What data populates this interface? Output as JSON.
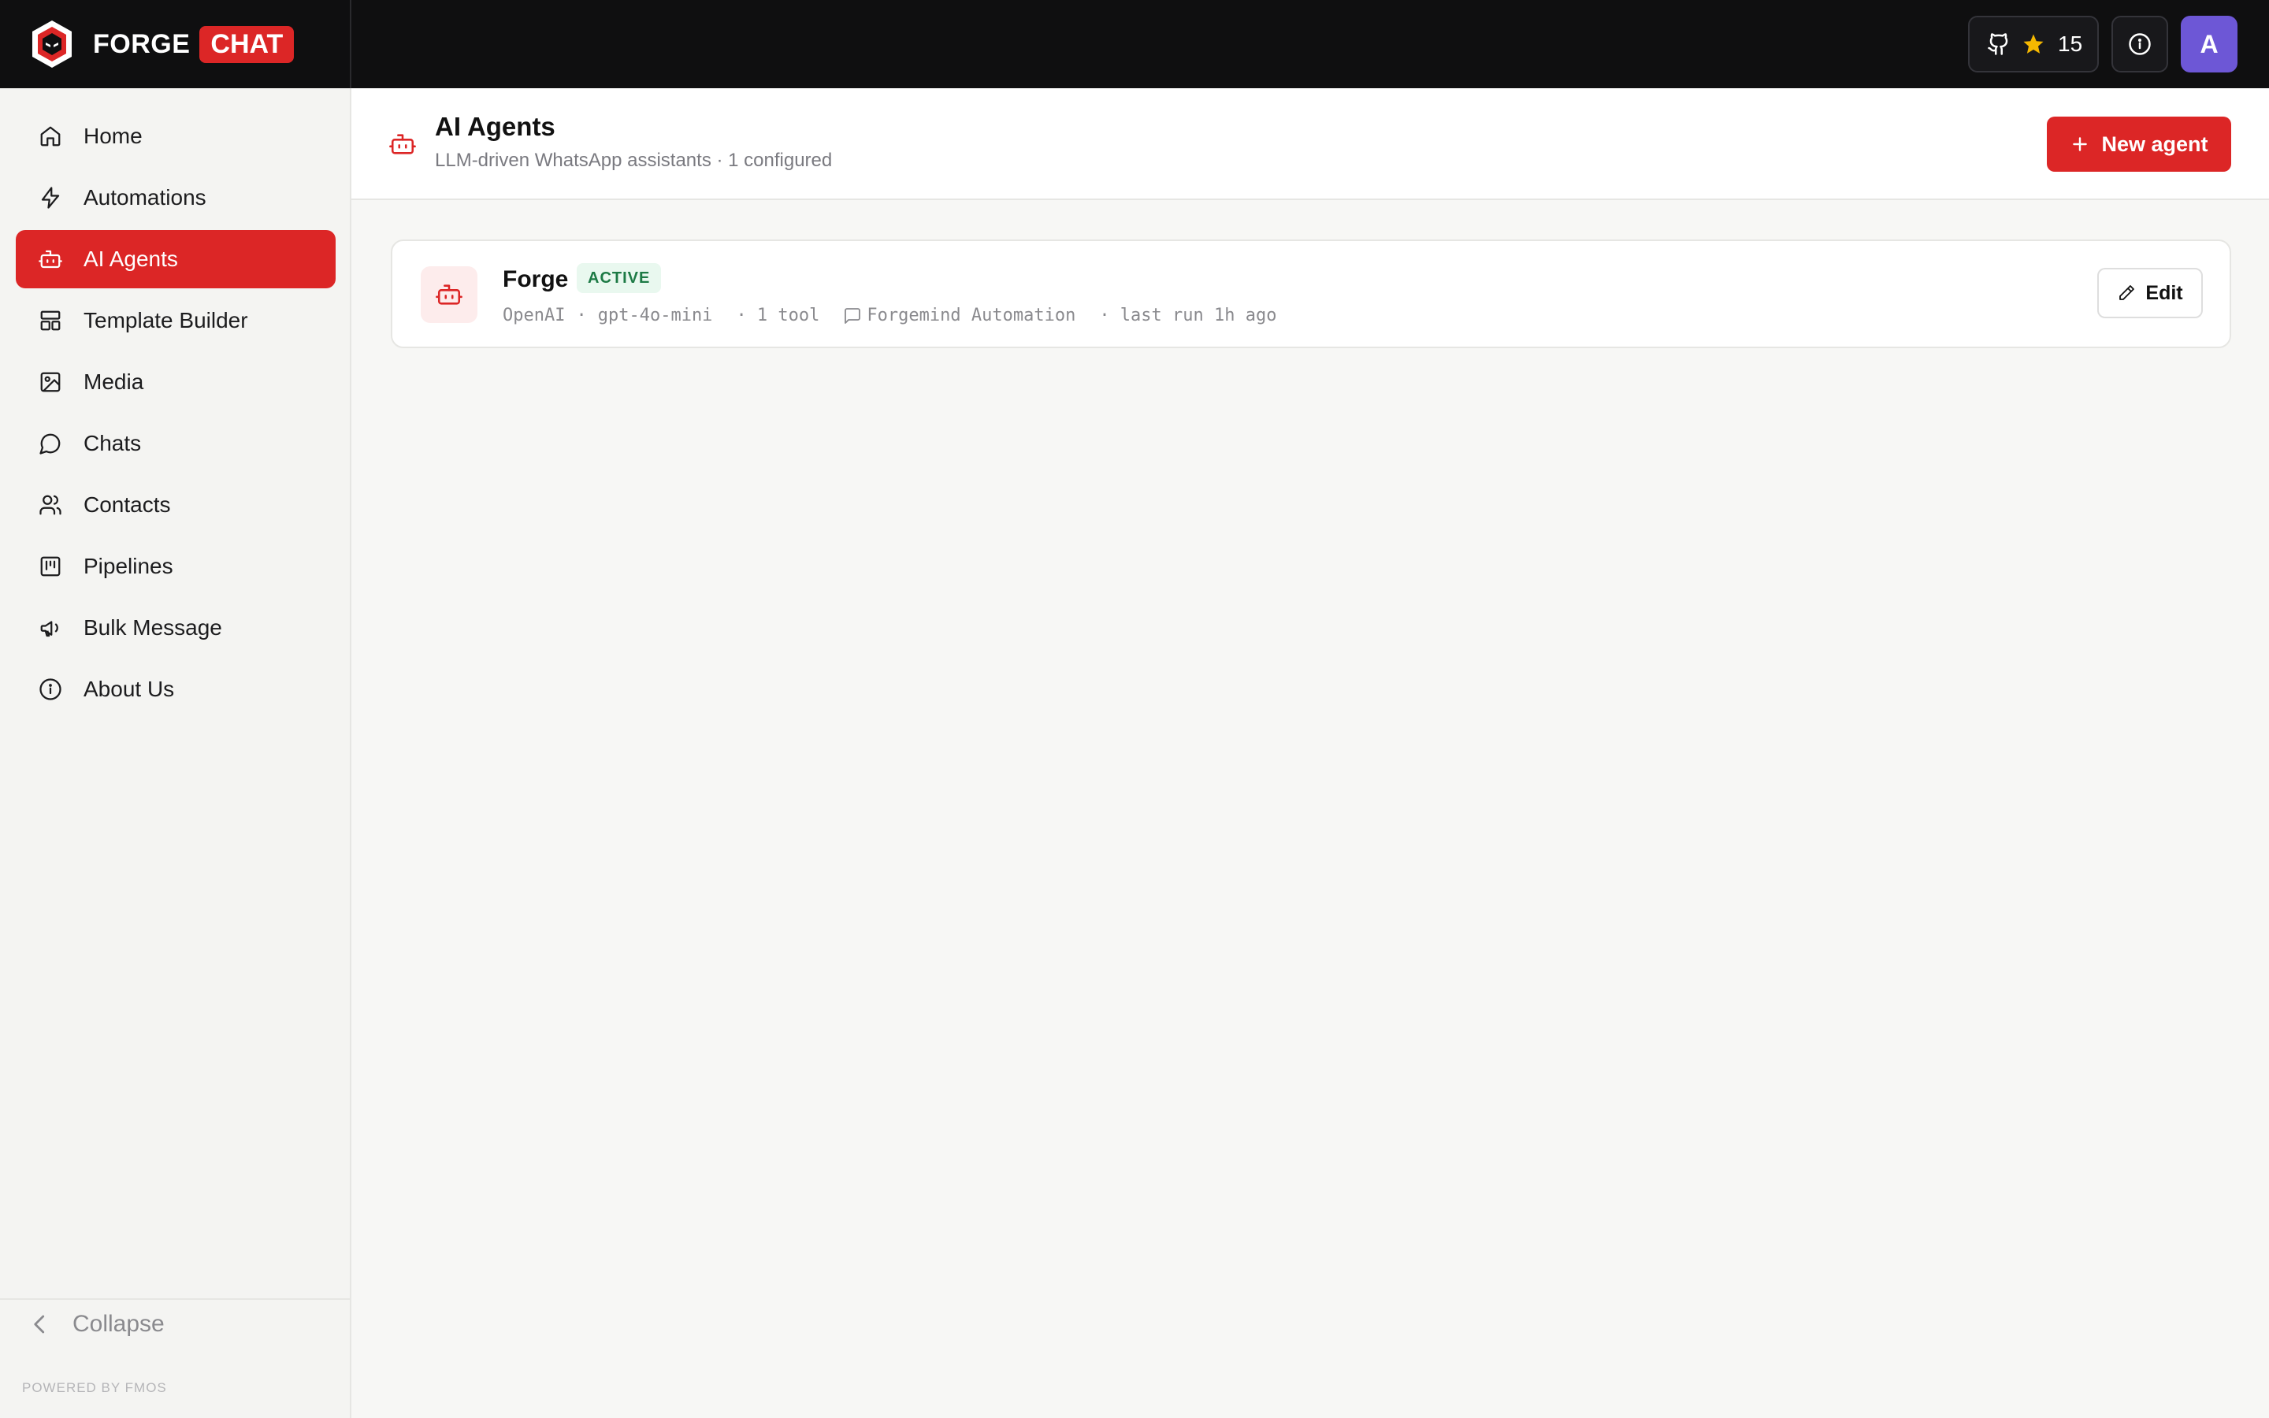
{
  "brand": {
    "name": "FORGE",
    "tag": "CHAT"
  },
  "topbar": {
    "github_stars": "15",
    "avatar_initial": "A"
  },
  "sidebar": {
    "items": [
      {
        "label": "Home",
        "icon": "home-icon"
      },
      {
        "label": "Automations",
        "icon": "lightning-icon"
      },
      {
        "label": "AI Agents",
        "icon": "bot-icon",
        "active": true
      },
      {
        "label": "Template Builder",
        "icon": "layout-icon"
      },
      {
        "label": "Media",
        "icon": "image-icon"
      },
      {
        "label": "Chats",
        "icon": "chat-icon"
      },
      {
        "label": "Contacts",
        "icon": "users-icon"
      },
      {
        "label": "Pipelines",
        "icon": "kanban-icon"
      },
      {
        "label": "Bulk Message",
        "icon": "megaphone-icon"
      },
      {
        "label": "About Us",
        "icon": "info-icon"
      }
    ],
    "collapse_label": "Collapse",
    "powered_by": "POWERED BY FMOS"
  },
  "page": {
    "title": "AI Agents",
    "subtitle": "LLM-driven WhatsApp assistants · 1 configured",
    "new_button": "New agent"
  },
  "agents": [
    {
      "name": "Forge",
      "status": "ACTIVE",
      "provider": "OpenAI",
      "model": "gpt-4o-mini",
      "tools": "· 1 tool",
      "channel": "Forgemind Automation",
      "last_run": "· last run 1h ago",
      "edit_label": "Edit"
    }
  ],
  "colors": {
    "accent": "#dc2626",
    "topbar": "#0f0f10",
    "avatar": "#6d57d6",
    "active_badge": "#1d7a45",
    "star": "#f5b800"
  }
}
